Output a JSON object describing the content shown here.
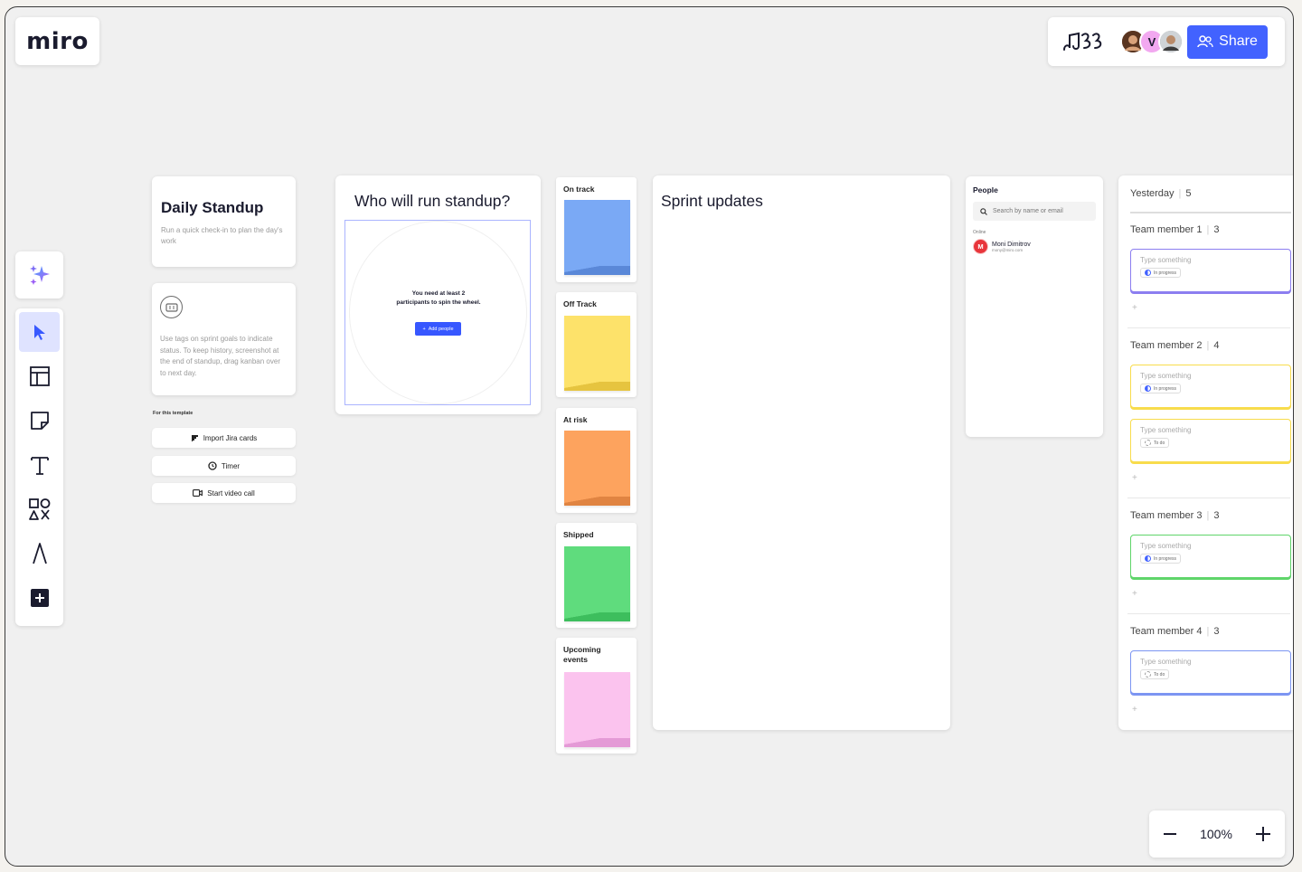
{
  "app": {
    "logo": "miro"
  },
  "header": {
    "share_label": "Share",
    "avatars": [
      {
        "initial": ""
      },
      {
        "initial": "V"
      },
      {
        "initial": ""
      }
    ]
  },
  "toolbar": {
    "tools": [
      "select-tool",
      "templates-tool",
      "sticky-note-tool",
      "text-tool",
      "shapes-tool",
      "pen-tool",
      "more-tools"
    ]
  },
  "standup": {
    "title": "Daily Standup",
    "subtitle": "Run a quick check-in to plan the day's work",
    "tags_text": "Use tags on sprint goals to indicate status. To keep history, screenshot at the end of standup, drag kanban over to next day.",
    "template_label": "For this template",
    "buttons": {
      "import_jira": "Import Jira cards",
      "timer": "Timer",
      "video_call": "Start video call"
    }
  },
  "wheel": {
    "title": "Who will run standup?",
    "message": "You need at least 2 participants to spin the wheel.",
    "add_people": "Add people"
  },
  "status_columns": [
    {
      "label": "On track",
      "color": "#7aa9f5"
    },
    {
      "label": "Off Track",
      "color": "#fde26a"
    },
    {
      "label": "At risk",
      "color": "#fda35e"
    },
    {
      "label": "Shipped",
      "color": "#5fdc7d"
    },
    {
      "label": "Upcoming events",
      "color": "#fbc3ee"
    }
  ],
  "sprint": {
    "title": "Sprint updates"
  },
  "people": {
    "title": "People",
    "search_placeholder": "Search by name or email",
    "online_label": "Online",
    "person": {
      "initial": "M",
      "name": "Moni Dimitrov",
      "email": "mony@miro.com"
    }
  },
  "yesterday": {
    "title": "Yesterday",
    "count": "5",
    "members": [
      {
        "name": "Team member 1",
        "count": "3",
        "color": "#8c7ef0",
        "tasks": [
          {
            "text": "Type something",
            "status": "In progress"
          }
        ]
      },
      {
        "name": "Team member 2",
        "count": "4",
        "color": "#f8dc4c",
        "tasks": [
          {
            "text": "Type something",
            "status": "In progress"
          },
          {
            "text": "Type something",
            "status": "To do"
          }
        ]
      },
      {
        "name": "Team member 3",
        "count": "3",
        "color": "#5fd56a",
        "tasks": [
          {
            "text": "Type something",
            "status": "In progress"
          }
        ]
      },
      {
        "name": "Team member 4",
        "count": "3",
        "color": "#7c95f2",
        "tasks": [
          {
            "text": "Type something",
            "status": "To do"
          }
        ]
      }
    ]
  },
  "zoom": {
    "value": "100%"
  }
}
